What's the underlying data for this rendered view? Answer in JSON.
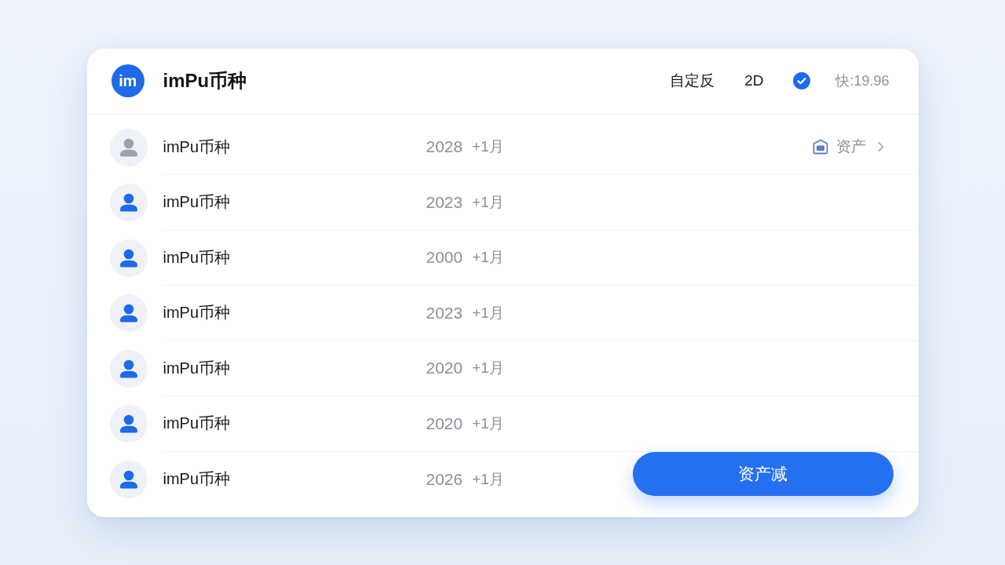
{
  "header": {
    "logo": "im",
    "title": "imPu币种",
    "mode": "自定反",
    "view": "2D",
    "checked": true,
    "rate": "快:19.96"
  },
  "rows": [
    {
      "name": "imPu币种",
      "year": "2028",
      "change": "+1月",
      "color": "#9aa1ab",
      "action": {
        "label": "资产"
      }
    },
    {
      "name": "imPu币种",
      "year": "2023",
      "change": "+1月",
      "color": "#1f6ae8"
    },
    {
      "name": "imPu币种",
      "year": "2000",
      "change": "+1月",
      "color": "#1f6ae8"
    },
    {
      "name": "imPu币种",
      "year": "2023",
      "change": "+1月",
      "color": "#1f6ae8"
    },
    {
      "name": "imPu币种",
      "year": "2020",
      "change": "+1月",
      "color": "#1f6ae8"
    },
    {
      "name": "imPu币种",
      "year": "2020",
      "change": "+1月",
      "color": "#1f6ae8"
    },
    {
      "name": "imPu币种",
      "year": "2026",
      "change": "+1月",
      "color": "#1f6ae8"
    }
  ],
  "primary_button": {
    "label": "资产减"
  }
}
